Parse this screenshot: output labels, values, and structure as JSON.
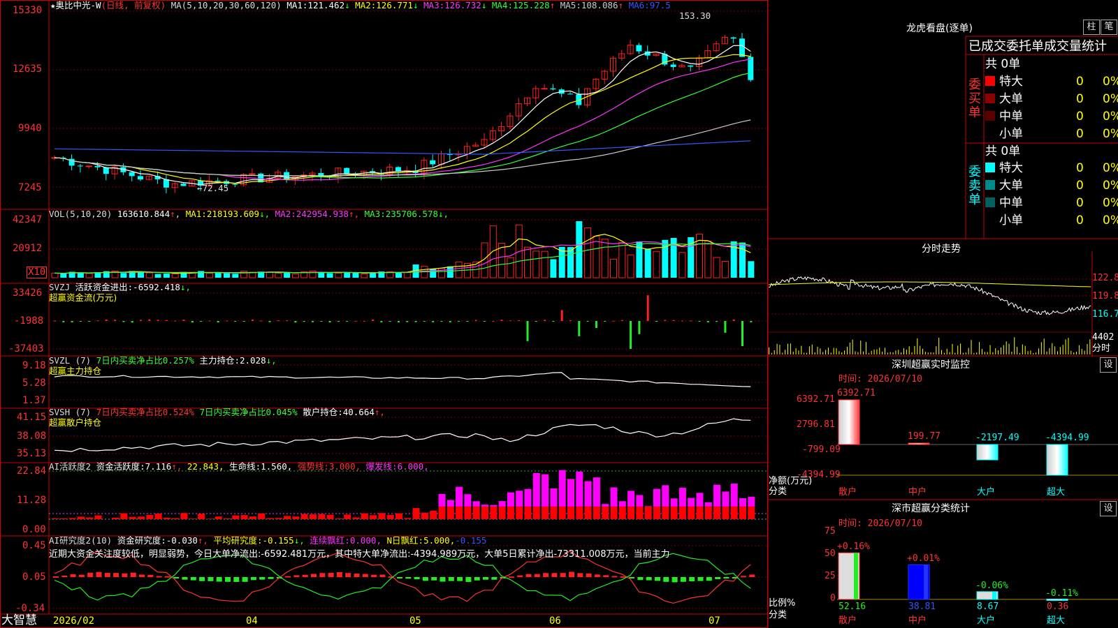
{
  "stock": {
    "name": "奥比中光-W",
    "period": "(日线, 前复权)"
  },
  "main_panel": {
    "ma_params": "MA(5,10,20,30,60,120)",
    "ma": [
      {
        "label": "MA1:",
        "value": "121.462",
        "arrow": "↓",
        "color": "#ffffff"
      },
      {
        "label": "MA2:",
        "value": "126.771",
        "arrow": "↓",
        "color": "#ffff00"
      },
      {
        "label": "MA3:",
        "value": "126.732",
        "arrow": "↓",
        "color": "#ff33ff"
      },
      {
        "label": "MA4:",
        "value": "125.228",
        "arrow": "↑",
        "color": "#33ff33"
      },
      {
        "label": "MA5:",
        "value": "108.086",
        "arrow": "↑",
        "color": "#cccccc"
      },
      {
        "label": "MA6:",
        "value": "97.5",
        "arrow": "",
        "color": "#3355ff"
      }
    ],
    "y_ticks": [
      "15330",
      "12635",
      "9940",
      "7245"
    ],
    "high_label": "153.30",
    "low_label": "←72.45"
  },
  "vol_panel": {
    "title": "VOL(5,10,20)",
    "value": "163610.844",
    "value_arrow": "↑",
    "ma": [
      {
        "label": "MA1:",
        "value": "218193.609",
        "arrow": "↓",
        "color": "#ffff00"
      },
      {
        "label": "MA2:",
        "value": "242954.938",
        "arrow": "↑",
        "color": "#ff33ff"
      },
      {
        "label": "MA3:",
        "value": "235706.578",
        "arrow": "↓",
        "color": "#33ff33"
      }
    ],
    "y_ticks": [
      "42347",
      "20912"
    ],
    "unit": "X10"
  },
  "svzj_panel": {
    "title": "SVZJ",
    "label": "活跃资金进出:",
    "value": "-6592.418",
    "arrow": "↓,",
    "subtitle": "超赢资金流(万元)",
    "y_ticks": [
      "33426",
      "-1988",
      "-37403"
    ]
  },
  "svzl_panel": {
    "title": "SVZL (7)",
    "label1": "7日内买卖净占比0.257%",
    "label2": "主力持仓:",
    "value2": "2.028",
    "arrow2": "↓,",
    "subtitle": "超赢主力持仓",
    "y_ticks": [
      "9.18",
      "5.28",
      "1.37"
    ]
  },
  "svsh_panel": {
    "title": "SVSH (7)",
    "label1": "7日内买卖净占比0.524%",
    "label2": "7日内买卖净占比0.045%",
    "label3": "散户持仓:",
    "value3": "40.664",
    "arrow3": "↑,",
    "subtitle": "超赢散户持仓",
    "y_ticks": [
      "41.15",
      "38.08",
      "35.13"
    ]
  },
  "ai_activity_panel": {
    "title": "AI活跃度2",
    "label": "资金活跃度:",
    "value": "7.116",
    "arrow": "↑,",
    "v2": "22.843,",
    "life_label": "生命线:",
    "life_value": "1.560,",
    "strong_label": "强势线:",
    "strong_value": "3.000,",
    "burst_label": "爆发线:",
    "burst_value": "6.000,",
    "y_ticks": [
      "22.84",
      "11.28",
      "0.00"
    ]
  },
  "ai_research_panel": {
    "title": "AI研究度2(10)",
    "label": "资金研究度:",
    "value": "-0.030",
    "arrow": "↑,",
    "avg_label": "平均研究度:",
    "avg_value": "-0.155",
    "avg_arrow": "↓,",
    "red_label": "连续飘红:",
    "red_value": "0.000,",
    "nred_label": "N日飘红:",
    "nred_value": "5.000,",
    "tail_value": "-0.155",
    "comment": "近期大资金关注度较低，明显弱势，今日大单净流出:-6592.481万元，其中特大单净流出:-4394.989万元，大单5日累计净出-73311.008万元，当前主力",
    "y_ticks": [
      "0.45",
      "0.05",
      "-0.34"
    ]
  },
  "time_axis": {
    "brand": "大智慧",
    "labels": [
      "2026/02",
      "04",
      "05",
      "06",
      "07"
    ]
  },
  "longhu": {
    "title": "龙虎看盘(逐单)",
    "btn_bar": "柱",
    "btn_list": "笔",
    "header": "已成交委托单成交量统计",
    "buy": {
      "side_label": "委买单",
      "total": "共 0单",
      "rows": [
        {
          "name": "特大",
          "count": "0",
          "pct": "0%",
          "color": "#ff0000"
        },
        {
          "name": "大单",
          "count": "0",
          "pct": "0%",
          "color": "#8b0000"
        },
        {
          "name": "中单",
          "count": "0",
          "pct": "0%",
          "color": "#5a0000"
        },
        {
          "name": "小单",
          "count": "0",
          "pct": "0%",
          "color": ""
        }
      ]
    },
    "sell": {
      "side_label": "委卖单",
      "total": "共 0单",
      "rows": [
        {
          "name": "特大",
          "count": "0",
          "pct": "0%",
          "color": "#00ffff"
        },
        {
          "name": "大单",
          "count": "0",
          "pct": "0%",
          "color": "#008b8b"
        },
        {
          "name": "中单",
          "count": "0",
          "pct": "0%",
          "color": "#006060"
        },
        {
          "name": "小单",
          "count": "0",
          "pct": "0%",
          "color": ""
        }
      ]
    }
  },
  "intraday": {
    "title": "分时走势",
    "price_ticks": [
      "122.8",
      "119.8",
      "116.7"
    ],
    "vol_ticks": [
      "4402",
      "分时"
    ]
  },
  "sz_monitor": {
    "title": "深圳超赢实时监控",
    "btn": "设",
    "time": "时间: 2026/07/10",
    "y_ticks": [
      "6392.71",
      "2796.81",
      "-799.09",
      "-4394.99"
    ],
    "axis_label": "净额(万元)",
    "cat_label": "分类"
  },
  "sz_stats": {
    "title": "深市超赢分类统计",
    "btn": "设",
    "time": "时间: 2026/07/10",
    "y_ticks": [
      "75",
      "50",
      "25",
      "0"
    ],
    "axis_label": "比例%",
    "cat_label": "分类"
  },
  "chart_data": [
    {
      "type": "bar",
      "title": "深圳超赢实时监控",
      "ylabel": "净额(万元)",
      "categories": [
        "散户",
        "中户",
        "大户",
        "超大"
      ],
      "values": [
        6392.71,
        199.77,
        -2197.49,
        -4394.99
      ],
      "value_labels": [
        "6392.71",
        "199.77",
        "-2197.49",
        "-4394.99"
      ],
      "ylim": [
        -4394.99,
        6392.71
      ]
    },
    {
      "type": "bar",
      "title": "深市超赢分类统计",
      "ylabel": "比例%",
      "categories": [
        "散户",
        "中户",
        "大户",
        "超大"
      ],
      "values": [
        52.16,
        38.81,
        8.67,
        0.36
      ],
      "value_labels": [
        "52.16",
        "38.81",
        "8.67",
        "0.36"
      ],
      "changes": [
        "+0.16%",
        "+0.01%",
        "-0.06%",
        "-0.11%"
      ],
      "ylim": [
        0,
        75
      ]
    }
  ],
  "colors": {
    "up": "#ff2020",
    "down": "#00ffff",
    "grid": "#8b0000",
    "axis": "#cc0000"
  }
}
